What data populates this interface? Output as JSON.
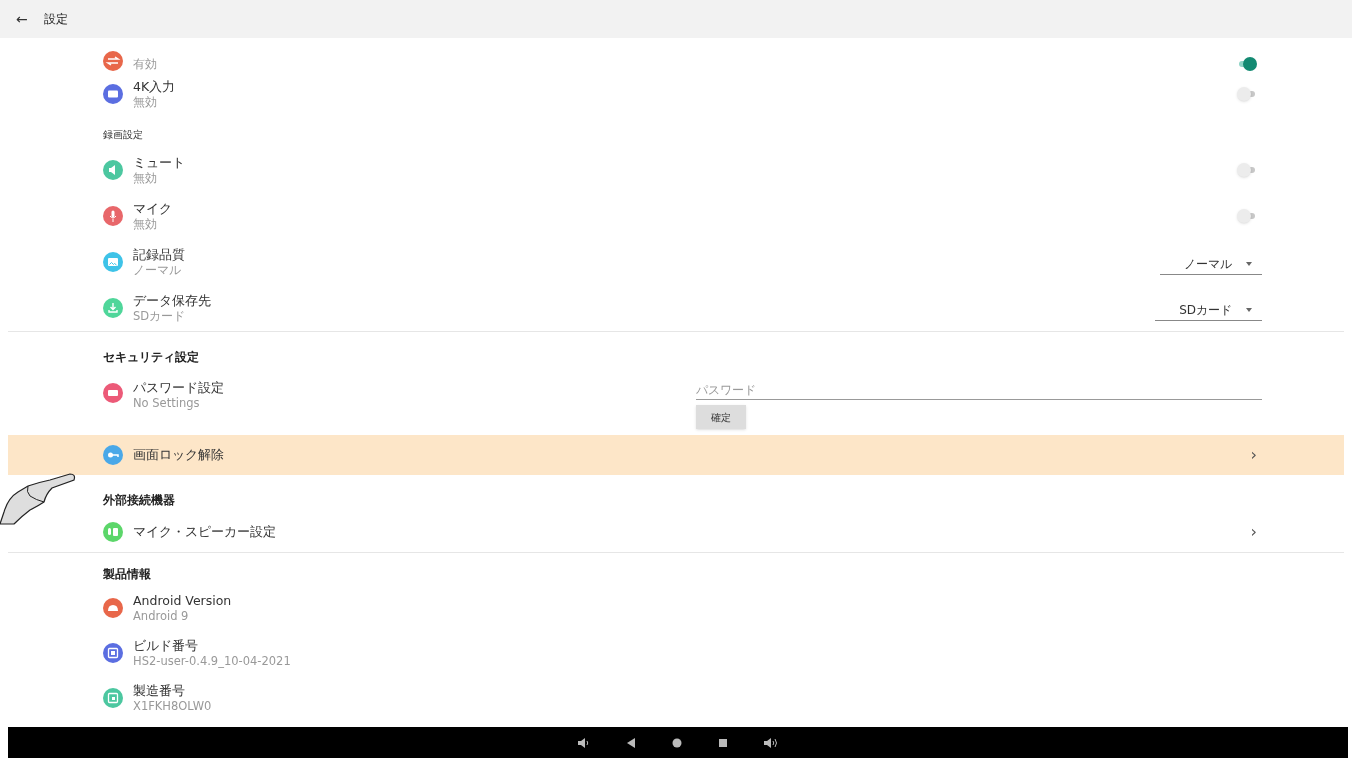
{
  "header": {
    "back": "←",
    "title": "設定"
  },
  "groups": [
    {
      "sections": [
        {
          "kind": "none",
          "items": [
            {
              "kind": "toggle",
              "subtitle": "有効",
              "color": "#e8674a",
              "on": true
            },
            {
              "kind": "toggle",
              "title": "4K入力",
              "subtitle": "無効",
              "color": "#5b6ee1",
              "on": false
            }
          ]
        },
        {
          "kind": "minor",
          "title": "録画設定",
          "items": [
            {
              "kind": "toggle",
              "title": "ミュート",
              "subtitle": "無効",
              "color": "#4cc7a0",
              "on": false
            },
            {
              "kind": "toggle",
              "title": "マイク",
              "subtitle": "無効",
              "color": "#e8676a",
              "on": false
            },
            {
              "kind": "dropdown",
              "title": "記録品質",
              "subtitle": "ノーマル",
              "color": "#3ec3e8",
              "value": "ノーマル"
            },
            {
              "kind": "dropdown",
              "title": "データ保存先",
              "subtitle": "SDカード",
              "color": "#4fd69a",
              "value": "SDカード"
            }
          ]
        }
      ]
    },
    {
      "sections": [
        {
          "kind": "major",
          "title": "セキュリティ設定",
          "items": [
            {
              "kind": "password",
              "title": "パスワード設定",
              "subtitle": "No Settings",
              "color": "#ec5a78",
              "placeholder": "パスワード",
              "button": "確定"
            },
            {
              "kind": "link",
              "title": "画面ロック解除",
              "color": "#4aa8e8",
              "highlighted": true,
              "chevron": "›"
            }
          ]
        },
        {
          "kind": "major",
          "title": "外部接続機器",
          "items": [
            {
              "kind": "link",
              "title": "マイク・スピーカー設定",
              "color": "#5cd66a",
              "highlighted": false,
              "chevron": "›"
            }
          ]
        }
      ]
    },
    {
      "sections": [
        {
          "kind": "major",
          "title": "製品情報",
          "items": [
            {
              "kind": "info",
              "title": "Android Version",
              "subtitle": "Android 9",
              "color": "#e8674a"
            },
            {
              "kind": "info",
              "title": "ビルド番号",
              "subtitle": "HS2-user-0.4.9_10-04-2021",
              "color": "#5b6ee1"
            },
            {
              "kind": "info",
              "title": "製造番号",
              "subtitle": "X1FKH8OLW0",
              "color": "#4cc7a0"
            }
          ]
        }
      ]
    }
  ]
}
